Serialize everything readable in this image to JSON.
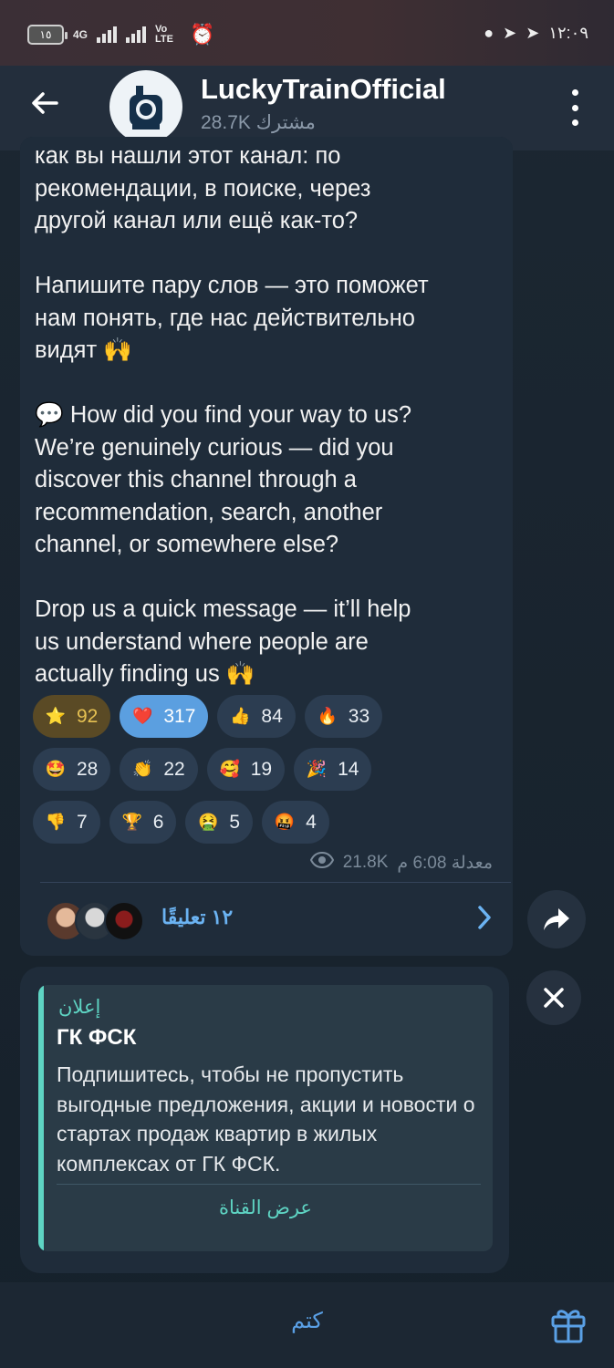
{
  "status_bar": {
    "battery": "١٥",
    "network_a": "4G",
    "network_b": "Vo LTE",
    "time": "١٢:٠٩",
    "icons": [
      "alarm-icon",
      "app-icon",
      "telegram-icon",
      "telegram-icon"
    ]
  },
  "header": {
    "title": "LuckyTrainOfficial",
    "subtitle": "28.7K مشترك"
  },
  "message": {
    "text_ru": "как вы нашли этот канал: по\nрекомендации, в поиске, через\nдругой канал или ещё как-то?\n\nНапишите пару слов — это поможет\nнам понять, где нас действительно\nвидят 🙌\n\n💬 How did you find your way to us?\nWe’re genuinely curious — did you\ndiscover this channel through a\nrecommendation, search, another\nchannel, or somewhere else?\n\nDrop us a quick message — it’ll help\nus understand where people are\nactually finding us 🙌",
    "reactions": [
      {
        "emoji": "⭐",
        "count": "92",
        "style": "gold"
      },
      {
        "emoji": "❤️",
        "count": "317",
        "style": "blue"
      },
      {
        "emoji": "👍",
        "count": "84",
        "style": "normal"
      },
      {
        "emoji": "🔥",
        "count": "33",
        "style": "normal"
      },
      {
        "emoji": "🤩",
        "count": "28",
        "style": "normal"
      },
      {
        "emoji": "👏",
        "count": "22",
        "style": "normal"
      },
      {
        "emoji": "🥰",
        "count": "19",
        "style": "normal"
      },
      {
        "emoji": "🎉",
        "count": "14",
        "style": "normal"
      },
      {
        "emoji": "👎",
        "count": "7",
        "style": "normal"
      },
      {
        "emoji": "🏆",
        "count": "6",
        "style": "normal"
      },
      {
        "emoji": "🤮",
        "count": "5",
        "style": "normal"
      },
      {
        "emoji": "🤬",
        "count": "4",
        "style": "normal"
      }
    ],
    "views": "21.8K",
    "time": "معدلة 6:08 م",
    "comments_label": "١٢ تعليقًا"
  },
  "ad": {
    "label": "إعلان",
    "title": "ГК ФСК",
    "body": "Подпишитесь, чтобы не пропустить выгодные предложения, акции и новости о стартах продаж квартир в жилых комплексах от ГК ФСК.",
    "button": "عرض القناة"
  },
  "bottom": {
    "mute_label": "كتم"
  },
  "colors": {
    "accent": "#6bb3f2",
    "ad_accent": "#5ed4c3",
    "bubble": "#1f2c3a",
    "header": "#232e3c"
  }
}
